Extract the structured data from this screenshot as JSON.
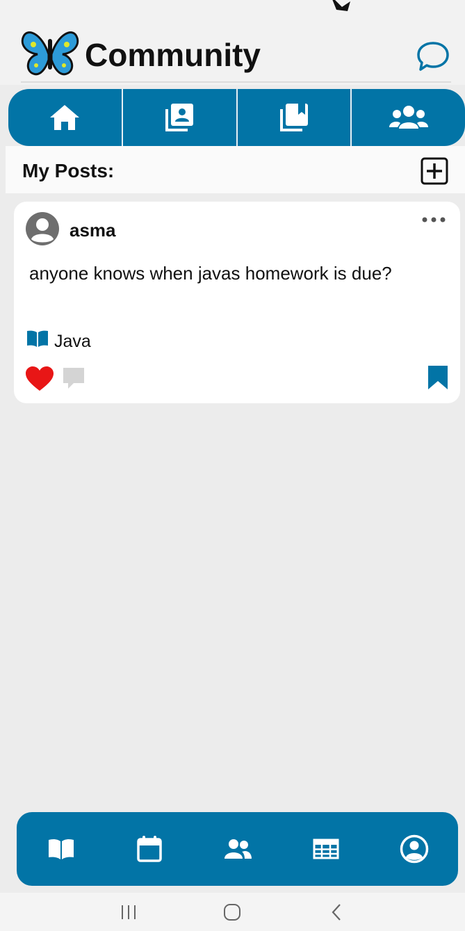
{
  "app": {
    "title": "Community",
    "accent_color": "#0274a6",
    "logo_icon": "butterfly-logo"
  },
  "header": {
    "chat_icon": "chat-bubble-icon"
  },
  "tabs": [
    {
      "name": "home",
      "icon": "home-icon"
    },
    {
      "name": "my-posts",
      "icon": "profile-posts-icon"
    },
    {
      "name": "saved",
      "icon": "bookmarks-icon"
    },
    {
      "name": "groups",
      "icon": "users-icon"
    }
  ],
  "section": {
    "title": "My Posts:",
    "add_icon": "add-square-icon"
  },
  "posts": [
    {
      "author": "asma",
      "text": "anyone knows when javas homework is due?",
      "tag": "Java",
      "liked": true,
      "like_color": "#e81616"
    }
  ],
  "bottom_nav": [
    {
      "name": "courses",
      "icon": "book-open-icon"
    },
    {
      "name": "calendar",
      "icon": "calendar-icon"
    },
    {
      "name": "community",
      "icon": "users-icon"
    },
    {
      "name": "schedule",
      "icon": "table-icon"
    },
    {
      "name": "profile",
      "icon": "user-circle-icon"
    }
  ]
}
